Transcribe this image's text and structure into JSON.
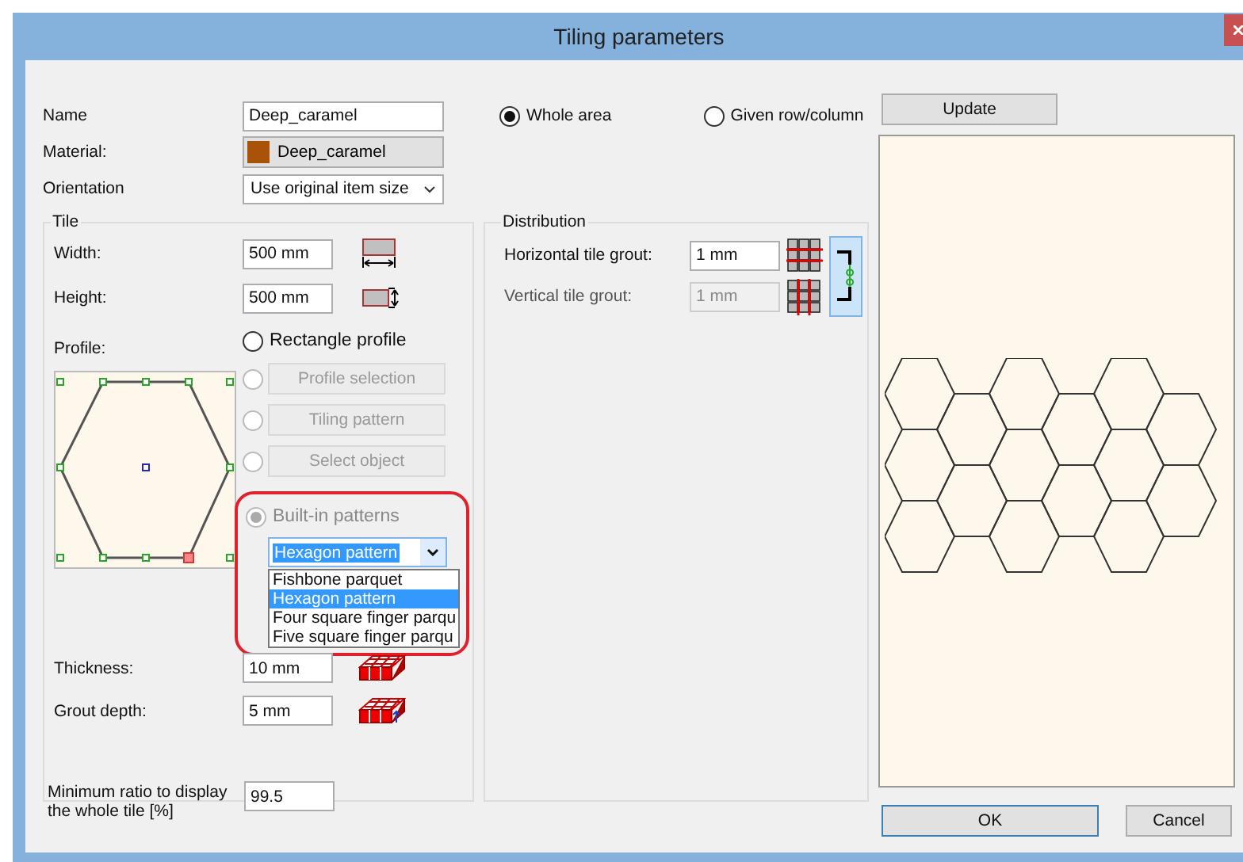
{
  "window": {
    "title": "Tiling parameters"
  },
  "fields": [
    {
      "label": "Name",
      "kind": "text",
      "value": "Deep_caramel"
    },
    {
      "label": "Material:",
      "kind": "material",
      "value": "Deep_caramel",
      "color": "#a8520a"
    },
    {
      "label": "Orientation",
      "kind": "select",
      "value": "Use original item size"
    }
  ],
  "tile": {
    "title": "Tile",
    "size_rows": [
      {
        "label": "Width:",
        "value": "500 mm",
        "kind": "width"
      },
      {
        "label": "Height:",
        "value": "500 mm",
        "kind": "height"
      }
    ],
    "profile": {
      "label": "Profile:",
      "options": [
        {
          "kind": "label",
          "label": "Rectangle profile",
          "selected": false,
          "disabled": false
        },
        {
          "kind": "button",
          "label": "Profile selection",
          "selected": false,
          "disabled": true
        },
        {
          "kind": "button",
          "label": "Tiling pattern",
          "selected": false,
          "disabled": true
        },
        {
          "kind": "button",
          "label": "Select object",
          "selected": false,
          "disabled": true
        },
        {
          "kind": "label",
          "label": "Built-in patterns",
          "selected": true,
          "disabled": true
        }
      ]
    },
    "pattern_select": {
      "value": "Hexagon pattern",
      "expanded": true,
      "highlighted": true,
      "options": [
        {
          "label": "Fishbone parquet",
          "selected": false
        },
        {
          "label": "Hexagon pattern",
          "selected": true
        },
        {
          "label": "Four square finger parqu",
          "selected": false
        },
        {
          "label": "Five square finger parqu",
          "selected": false
        }
      ]
    },
    "depth_rows": [
      {
        "label": "Thickness:",
        "value": "10 mm",
        "kind": "thickness"
      },
      {
        "label": "Grout depth:",
        "value": "5 mm",
        "kind": "grout"
      }
    ],
    "min_ratio": {
      "label": "Minimum ratio to display the whole tile [%]",
      "value": "99.5"
    }
  },
  "area": [
    {
      "label": "Whole area",
      "selected": true
    },
    {
      "label": "Given row/column",
      "selected": false
    }
  ],
  "update_button": "Update",
  "distribution": {
    "title": "Distribution",
    "linked": true,
    "rows": [
      {
        "label": "Horizontal tile grout:",
        "value": "1 mm",
        "disabled": false,
        "kind": "horizontal"
      },
      {
        "label": "Vertical tile grout:",
        "value": "1 mm",
        "disabled": true,
        "kind": "vertical"
      }
    ]
  },
  "buttons": [
    {
      "label": "OK",
      "focused": true
    },
    {
      "label": "Cancel",
      "focused": false
    }
  ]
}
